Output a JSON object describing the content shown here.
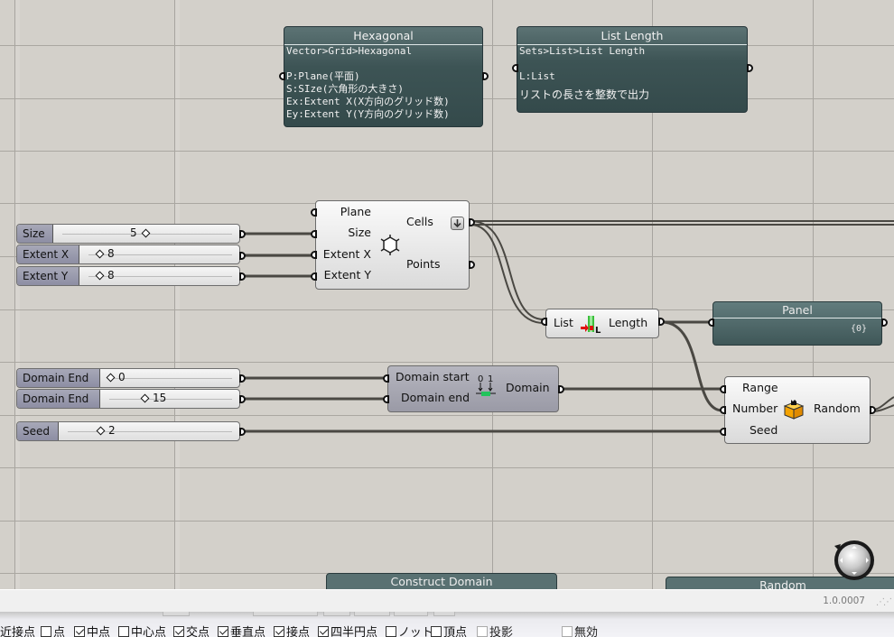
{
  "canvas": {
    "scribbles": [
      {
        "title": "Hexagonal",
        "lines": [
          "Vector>Grid>Hexagonal",
          "",
          "P:Plane(平面)",
          "S:SIze(六角形の大きさ)",
          "Ex:Extent X(X方向のグリッド数)",
          "Ey:Extent Y(Y方向のグリッド数)"
        ]
      },
      {
        "title": "List Length",
        "lines": [
          "Sets>List>List Length",
          "",
          "L:List",
          "リストの長さを整数で出力"
        ]
      }
    ],
    "sliders": [
      {
        "label": "Size",
        "value": "5",
        "position": 0.55
      },
      {
        "label": "Extent X",
        "value": "8",
        "position": 0.1
      },
      {
        "label": "Extent Y",
        "value": "8",
        "position": 0.1
      },
      {
        "label": "Domain End",
        "value": "0",
        "position": 0.03
      },
      {
        "label": "Domain End",
        "value": "15",
        "position": 0.3
      },
      {
        "label": "Seed",
        "value": "2",
        "position": 0.3
      }
    ],
    "hexagonal": {
      "inputs": [
        "Plane",
        "Size",
        "Extent X",
        "Extent Y"
      ],
      "outputs": [
        "Cells",
        "Points"
      ],
      "icon": "hexagon-grid-icon",
      "graft_icon": "flatten-arrow-icon"
    },
    "list_length": {
      "input": "List",
      "output": "Length",
      "icon": "list-length-icon"
    },
    "panel": {
      "title": "Panel",
      "value": "{0}"
    },
    "construct_domain": {
      "inputs": [
        "Domain start",
        "Domain end"
      ],
      "output": "Domain",
      "icon": "construct-domain-icon",
      "icon_labels": [
        "0",
        "1"
      ]
    },
    "random": {
      "inputs": [
        "Range",
        "Number",
        "Seed"
      ],
      "output": "Random",
      "icon": "random-dice-icon"
    },
    "bottom_components": [
      "Construct Domain",
      "Random"
    ]
  },
  "statusbar": {
    "version": "1.0.0007"
  },
  "osnap": {
    "items": [
      {
        "label": "近接点",
        "checked": null
      },
      {
        "label": "点",
        "checked": false
      },
      {
        "label": "中点",
        "checked": true
      },
      {
        "label": "中心点",
        "checked": false
      },
      {
        "label": "交点",
        "checked": true
      },
      {
        "label": "垂直点",
        "checked": true
      },
      {
        "label": "接点",
        "checked": true
      },
      {
        "label": "四半円点",
        "checked": true
      },
      {
        "label": "ノット",
        "checked": false
      },
      {
        "label": "頂点",
        "checked": false
      },
      {
        "label": "投影",
        "checked": false,
        "disabled": true
      },
      {
        "label": "無効",
        "checked": false,
        "disabled": true
      }
    ]
  },
  "colors": {
    "canvas": "#d3d0ca",
    "scribble": "#3d5455",
    "wire": "#4a4843",
    "domain_icon_green": "#22c35c",
    "dice_orange": "#f5a300"
  }
}
